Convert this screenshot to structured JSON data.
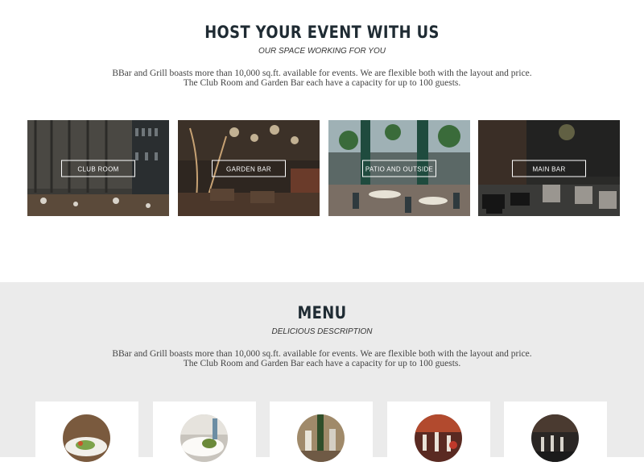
{
  "events": {
    "title": "HOST YOUR EVENT WITH US",
    "subtitle": "OUR SPACE WORKING FOR YOU",
    "description_line1": "BBar and Grill boasts more than 10,000 sq.ft. available for events. We are flexible both with the layout and price.",
    "description_line2": "The Club Room and Garden Bar each have a capacity for up to 100 guests.",
    "venues": [
      {
        "label": "CLUB ROOM"
      },
      {
        "label": "GARDEN BAR"
      },
      {
        "label": "PATIO AND OUTSIDE"
      },
      {
        "label": "MAIN BAR"
      }
    ]
  },
  "menu": {
    "title": "MENU",
    "subtitle": "DELICIOUS DESCRIPTION",
    "description_line1": "BBar and Grill boasts more than 10,000 sq.ft. available for events. We are flexible both with the layout and price.",
    "description_line2": "The Club Room and Garden Bar each have a capacity for up to 100 guests."
  },
  "colors": {
    "heading": "#1f2b33",
    "menu_background": "#ebebeb"
  }
}
